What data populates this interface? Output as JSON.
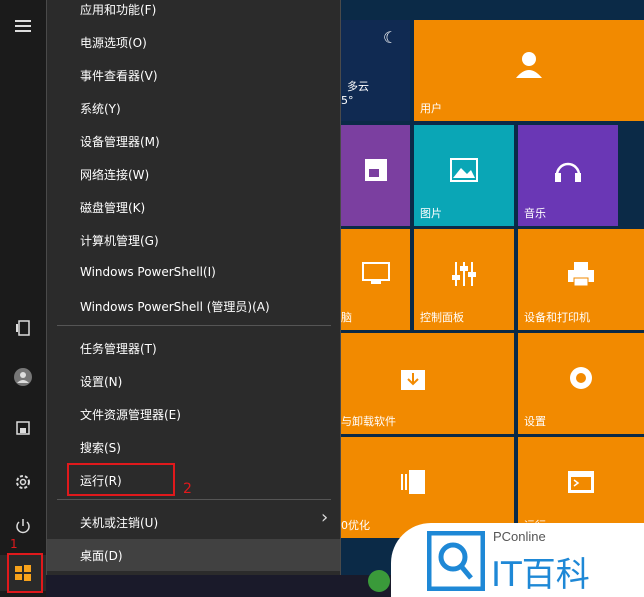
{
  "menu": {
    "items_top": [
      {
        "label": "应用和功能(F)"
      },
      {
        "label": "电源选项(O)"
      },
      {
        "label": "事件查看器(V)"
      },
      {
        "label": "系统(Y)"
      },
      {
        "label": "设备管理器(M)"
      },
      {
        "label": "网络连接(W)"
      },
      {
        "label": "磁盘管理(K)"
      },
      {
        "label": "计算机管理(G)"
      },
      {
        "label": "Windows PowerShell(I)"
      },
      {
        "label": "Windows PowerShell (管理员)(A)"
      }
    ],
    "items_mid": [
      {
        "label": "任务管理器(T)"
      },
      {
        "label": "设置(N)"
      },
      {
        "label": "文件资源管理器(E)"
      },
      {
        "label": "搜索(S)"
      },
      {
        "label": "运行(R)"
      }
    ],
    "shutdown_label": "关机或注销(U)",
    "desktop_label": "桌面(D)",
    "chevron": "›"
  },
  "annotations": {
    "step1": "1",
    "step2": "2",
    "color": "#e0191c"
  },
  "tiles": {
    "weather_label": "多云",
    "weather_temp": "5°",
    "user_label": "用户",
    "pictures_label": "图片",
    "music_label": "音乐",
    "control_panel_label": "控制面板",
    "devices_printers_label": "设备和打印机",
    "partial_label_1": "脑",
    "uninstall_label": "与卸载软件",
    "settings_label": "设置",
    "optimize_label": "0优化",
    "run_label": "运行"
  },
  "watermark": {
    "brand_small": "PConline",
    "brand_big": "IT百科"
  },
  "colors": {
    "tile_orange": "#f28a00",
    "tile_purple": "#7b3fa0",
    "tile_teal": "#0aa6b6",
    "menu_bg": "#2b2b2b"
  },
  "icons": {
    "rail": [
      "hamburger-icon",
      "tablet-icon",
      "user-icon",
      "file-icon",
      "gear-icon",
      "power-icon",
      "windows-start-icon"
    ]
  }
}
